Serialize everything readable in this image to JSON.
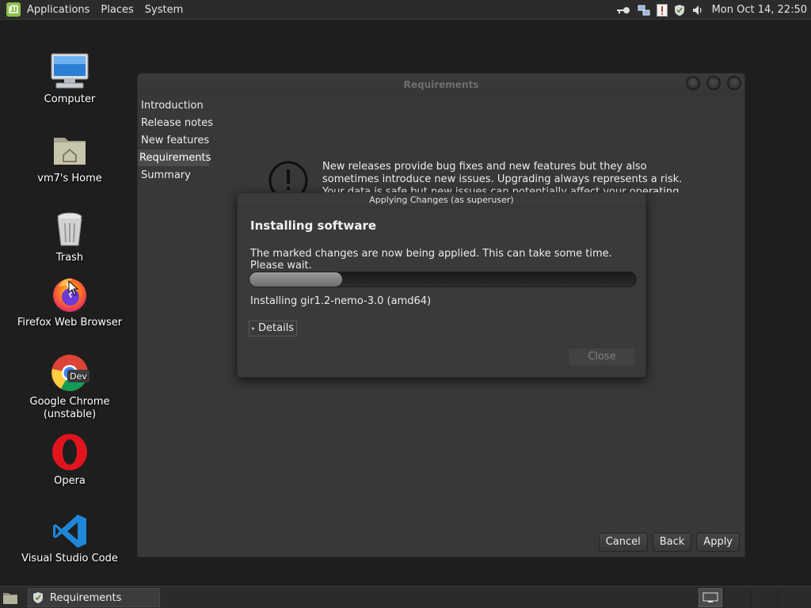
{
  "top_panel": {
    "menus": [
      "Applications",
      "Places",
      "System"
    ],
    "clock": "Mon Oct 14, 22:50"
  },
  "desktop_icons": [
    {
      "label": "Computer",
      "icon": "computer-icon"
    },
    {
      "label": "vm7's Home",
      "icon": "home-folder-icon"
    },
    {
      "label": "Trash",
      "icon": "trash-icon"
    },
    {
      "label": "Firefox Web Browser",
      "icon": "firefox-icon"
    },
    {
      "label": "Google Chrome (unstable)",
      "icon": "chrome-dev-icon",
      "badge": "Dev"
    },
    {
      "label": "Opera",
      "icon": "opera-icon"
    },
    {
      "label": "Visual Studio Code",
      "icon": "vscode-icon"
    }
  ],
  "main_window": {
    "title": "Requirements",
    "sidebar": [
      "Introduction",
      "Release notes",
      "New features",
      "Requirements",
      "Summary"
    ],
    "active_sidebar": "Requirements",
    "warning_text": "New releases provide bug fixes and new features but they also sometimes introduce new issues. Upgrading always represents a risk. Your data is safe but new issues can potentially affect your operating system.",
    "buttons": {
      "cancel": "Cancel",
      "back": "Back",
      "apply": "Apply"
    }
  },
  "dialog": {
    "title": "Applying Changes (as superuser)",
    "heading": "Installing software",
    "message": "The marked changes are now being applied. This can take some time. Please wait.",
    "progress_fraction": 0.24,
    "status": "Installing gir1.2-nemo-3.0 (amd64)",
    "details_label": "Details",
    "close_label": "Close"
  },
  "taskbar": {
    "task_label": "Requirements"
  },
  "colors": {
    "desktop_bg": "#1e1e1e",
    "panel_bg": "#2b2b2b",
    "window_bg": "#383838",
    "mint_green": "#8bbf4a"
  }
}
